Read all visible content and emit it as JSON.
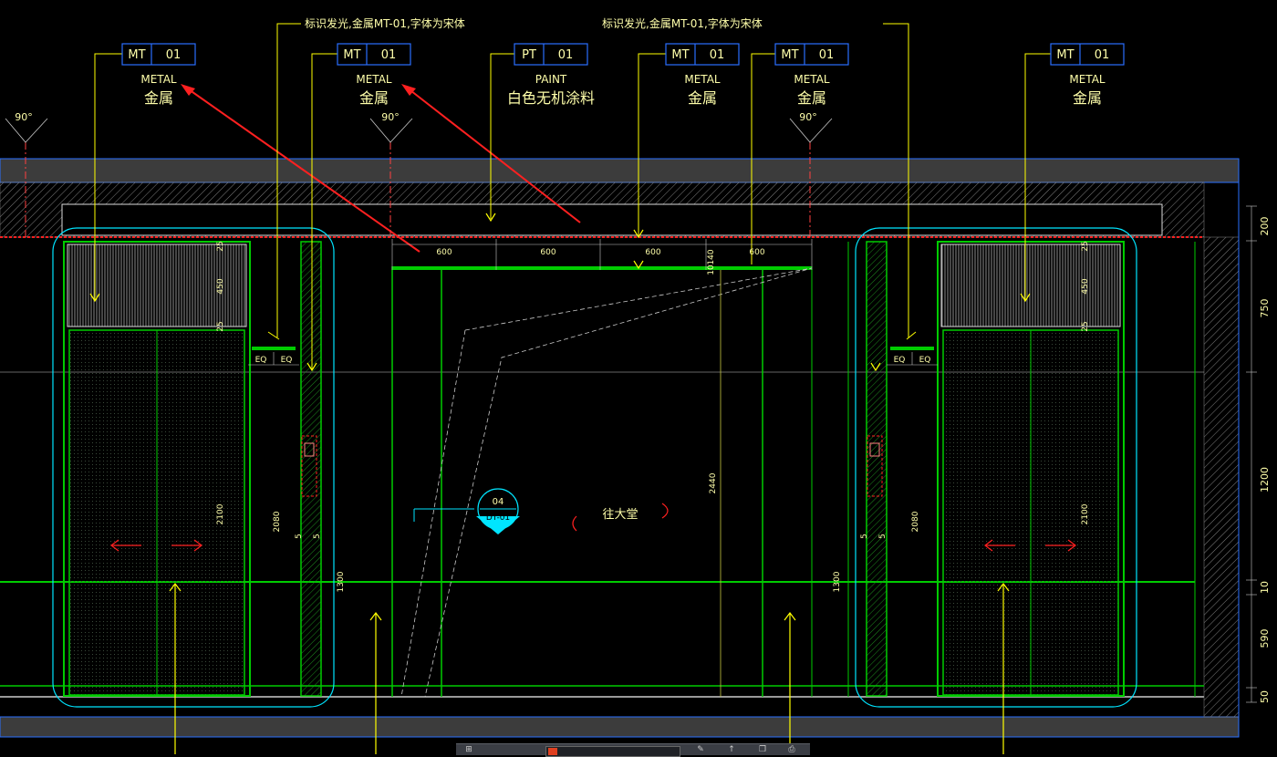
{
  "annotations": {
    "note_left": "标识发光,金属MT-01,字体为宋体",
    "note_right": "标识发光,金属MT-01,字体为宋体",
    "lobby_label": "往大堂",
    "door_tag_top": "04",
    "door_tag_bottom": "DT-01"
  },
  "material_tags": [
    {
      "code": "MT",
      "num": "01",
      "en": "METAL",
      "cn": "金属"
    },
    {
      "code": "MT",
      "num": "01",
      "en": "METAL",
      "cn": "金属"
    },
    {
      "code": "PT",
      "num": "01",
      "en": "PAINT",
      "cn": "白色无机涂料"
    },
    {
      "code": "MT",
      "num": "01",
      "en": "METAL",
      "cn": "金属"
    },
    {
      "code": "MT",
      "num": "01",
      "en": "METAL",
      "cn": "金属"
    },
    {
      "code": "MT",
      "num": "01",
      "en": "METAL",
      "cn": "金属"
    }
  ],
  "angles": [
    "90°",
    "90°",
    "90°"
  ],
  "dimensions": {
    "top_spans": [
      "600",
      "600",
      "600",
      "600"
    ],
    "small_140": "140",
    "small_10": "10",
    "eq": "EQ",
    "v_25": "25",
    "v_450": "450",
    "v_2100": "2100",
    "v_2080": "2080",
    "v_5": "5",
    "v_1300": "1300",
    "v_2440": "2440",
    "right_ladder": [
      "200",
      "750",
      "1200",
      "10",
      "590",
      "50"
    ]
  },
  "colors": {
    "background": "#000000",
    "yellow": "#ffff00",
    "green": "#00cc00",
    "cyan": "#00e5ff",
    "red": "#ff2020",
    "blue": "#2a6fff",
    "gray_band": "#3c3c3c"
  }
}
